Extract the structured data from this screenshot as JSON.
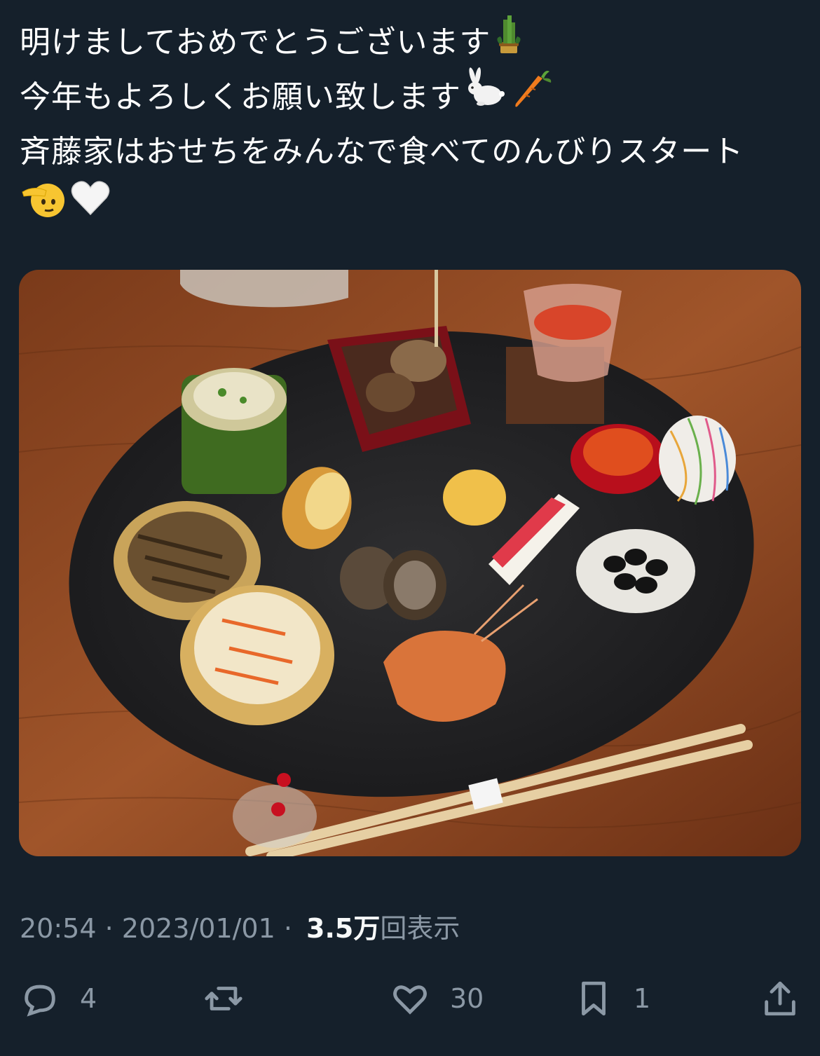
{
  "tweet": {
    "lines": [
      "明けましておめでとうございます",
      "今年もよろしくお願い致します",
      "斉藤家はおせちをみんなで食べてのんびりスタート"
    ],
    "emojis": {
      "line1": [
        "kadomatsu-icon"
      ],
      "line2": [
        "rabbit-icon",
        "carrot-icon"
      ],
      "line4": [
        "saluting-face-icon",
        "white-heart-icon"
      ]
    }
  },
  "photo": {
    "icon": "osechi-photo"
  },
  "meta": {
    "time": "20:54",
    "separator": " · ",
    "date": "2023/01/01",
    "views_count": "3.5万",
    "views_label": "回表示"
  },
  "actions": {
    "reply_count": "4",
    "retweet_count": "",
    "like_count": "30",
    "bookmark_count": "1"
  },
  "colors": {
    "background": "#15202b",
    "text": "#ffffff",
    "secondary": "#8b98a5"
  }
}
